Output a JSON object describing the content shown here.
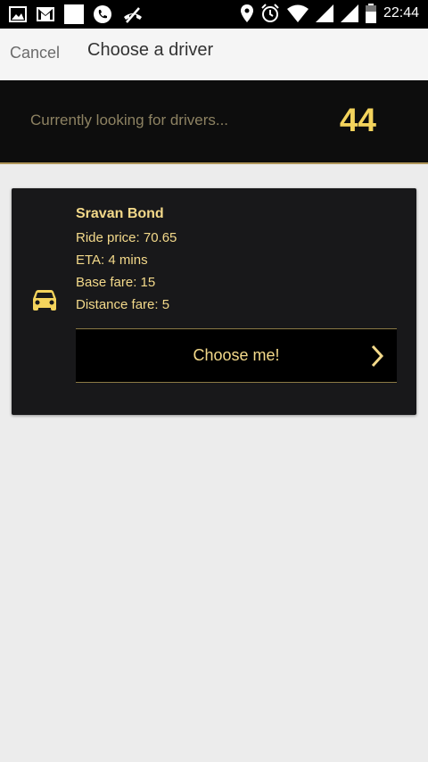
{
  "status_bar": {
    "time": "22:44",
    "left_icons": [
      "gallery-icon",
      "gmail-icon",
      "blank-notification-icon",
      "phone-icon",
      "missed-call-icon"
    ],
    "right_icons": [
      "location-icon",
      "alarm-icon",
      "wifi-icon",
      "signal-icon",
      "signal-icon",
      "battery-icon"
    ]
  },
  "header": {
    "cancel_label": "Cancel",
    "title": "Choose a driver"
  },
  "banner": {
    "text": "Currently looking for drivers...",
    "count": "44"
  },
  "driver": {
    "name": "Sravan Bond",
    "ride_price": "Ride price: 70.65",
    "eta": "ETA: 4 mins",
    "base_fare": "Base fare: 15",
    "distance_fare": "Distance fare: 5",
    "choose_label": "Choose me!",
    "icon": "car-icon"
  },
  "colors": {
    "accent": "#f3d35c",
    "card_text": "#f3d98a",
    "card_bg": "#18181a",
    "banner_bg": "#0d0d0d",
    "page_bg": "#ececec"
  }
}
